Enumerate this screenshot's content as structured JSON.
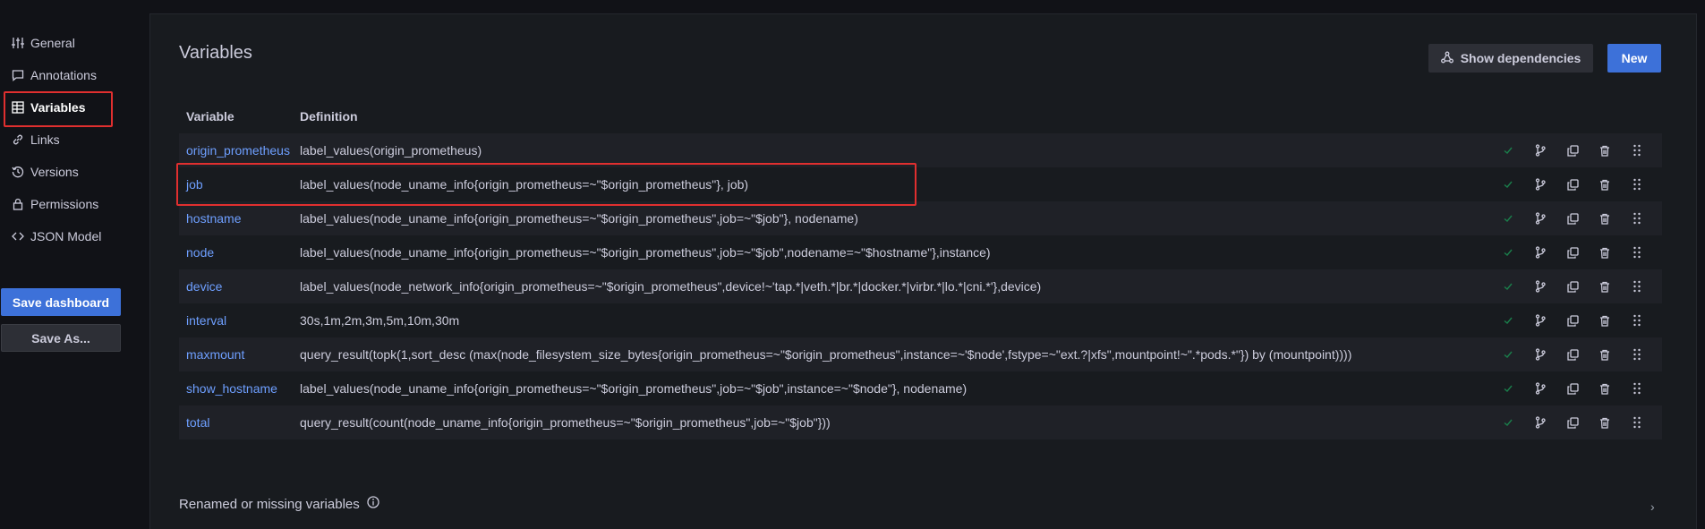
{
  "sidebar": {
    "items": [
      {
        "label": "General",
        "icon": "sliders-icon"
      },
      {
        "label": "Annotations",
        "icon": "comment-icon"
      },
      {
        "label": "Variables",
        "icon": "table-icon",
        "active": true
      },
      {
        "label": "Links",
        "icon": "link-icon"
      },
      {
        "label": "Versions",
        "icon": "history-icon"
      },
      {
        "label": "Permissions",
        "icon": "lock-icon"
      },
      {
        "label": "JSON Model",
        "icon": "code-icon"
      }
    ],
    "save_label": "Save dashboard",
    "save_as_label": "Save As..."
  },
  "main": {
    "title": "Variables",
    "show_deps_label": "Show dependencies",
    "new_label": "New",
    "columns": {
      "variable": "Variable",
      "definition": "Definition"
    },
    "rows": [
      {
        "name": "origin_prometheus",
        "definition": "label_values(origin_prometheus)"
      },
      {
        "name": "job",
        "definition": "label_values(node_uname_info{origin_prometheus=~\"$origin_prometheus\"}, job)"
      },
      {
        "name": "hostname",
        "definition": "label_values(node_uname_info{origin_prometheus=~\"$origin_prometheus\",job=~\"$job\"}, nodename)"
      },
      {
        "name": "node",
        "definition": "label_values(node_uname_info{origin_prometheus=~\"$origin_prometheus\",job=~\"$job\",nodename=~\"$hostname\"},instance)"
      },
      {
        "name": "device",
        "definition": "label_values(node_network_info{origin_prometheus=~\"$origin_prometheus\",device!~'tap.*|veth.*|br.*|docker.*|virbr.*|lo.*|cni.*'},device)"
      },
      {
        "name": "interval",
        "definition": "30s,1m,2m,3m,5m,10m,30m"
      },
      {
        "name": "maxmount",
        "definition": "query_result(topk(1,sort_desc (max(node_filesystem_size_bytes{origin_prometheus=~\"$origin_prometheus\",instance=~'$node',fstype=~\"ext.?|xfs\",mountpoint!~\".*pods.*\"}) by (mountpoint))))"
      },
      {
        "name": "show_hostname",
        "definition": "label_values(node_uname_info{origin_prometheus=~\"$origin_prometheus\",job=~\"$job\",instance=~\"$node\"}, nodename)"
      },
      {
        "name": "total",
        "definition": "query_result(count(node_uname_info{origin_prometheus=~\"$origin_prometheus\",job=~\"$job\"}))"
      }
    ],
    "renamed_label": "Renamed or missing variables"
  },
  "colors": {
    "accent": "#3d71d9",
    "link": "#6e9fff",
    "check": "#1a7f4b",
    "highlight": "#e02f2f"
  }
}
